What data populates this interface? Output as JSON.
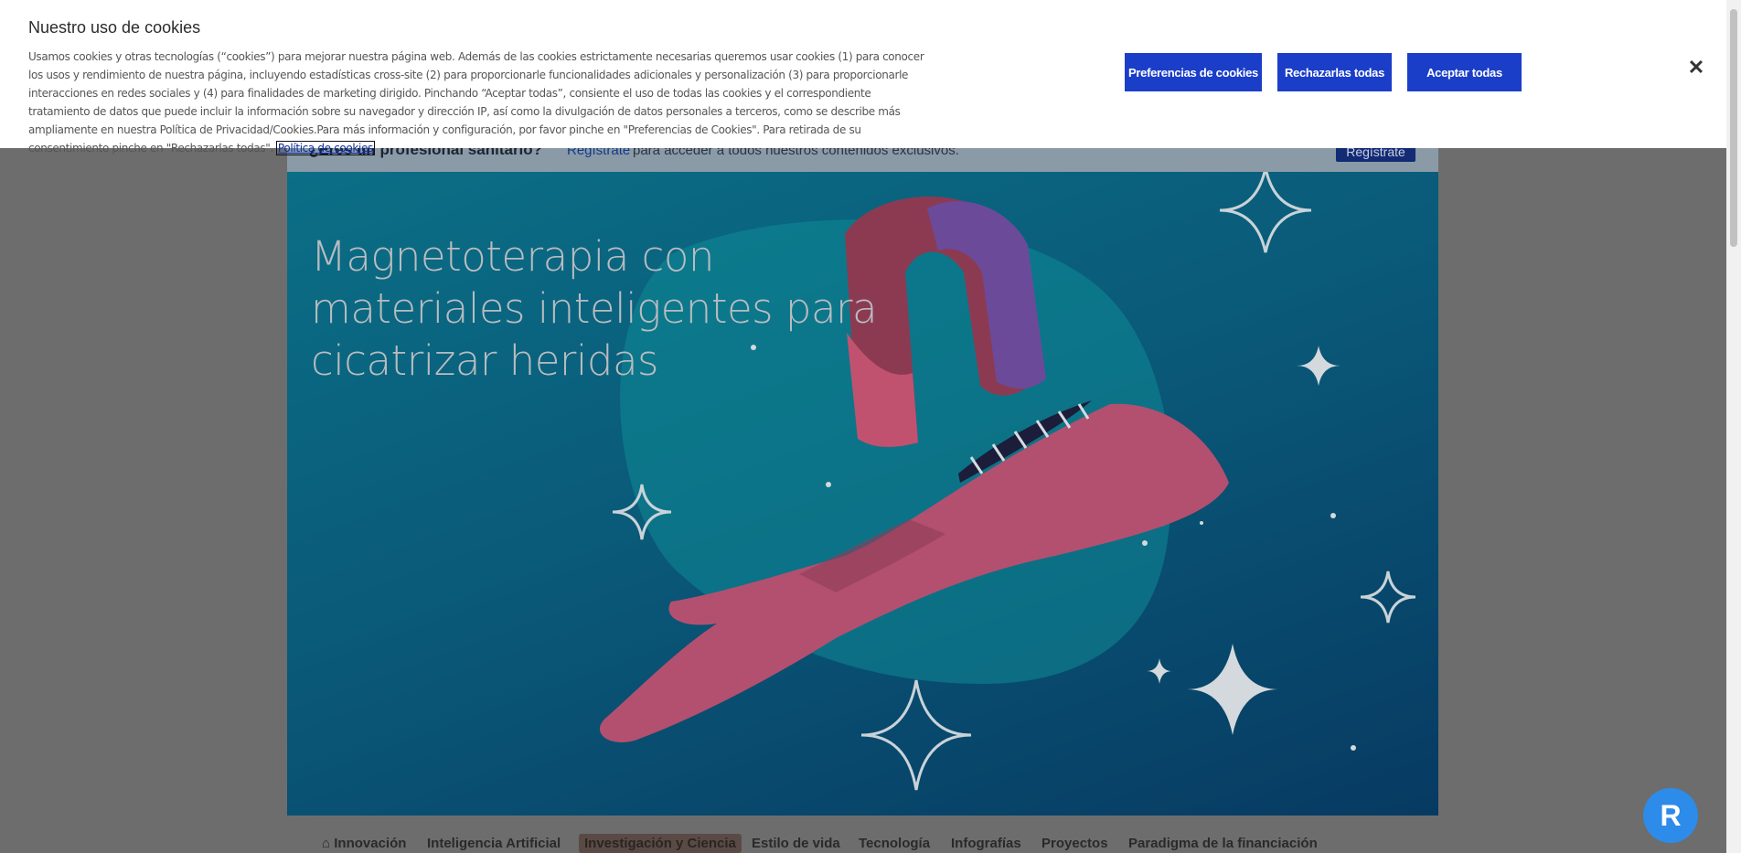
{
  "cookie_banner": {
    "title": "Nuestro uso de cookies",
    "body": "Usamos cookies y otras tecnologías (“cookies”) para mejorar nuestra página web. Además de las cookies estrictamente necesarias queremos usar cookies (1) para conocer los usos y rendimiento de nuestra página, incluyendo estadísticas cross-site (2) para proporcionarle funcionalidades adicionales y personalización (3) para proporcionarle interacciones en redes sociales y (4) para finalidades de marketing dirigido. Pinchando “Aceptar todas”, consiente el uso de todas las cookies y el correspondiente tratamiento de datos que puede incluir la información sobre su navegador y dirección IP, así como la divulgación de datos personales a terceros, como se describe más ampliamente en nuestra Política de Privacidad/Cookies.Para más información y configuración, por favor pinche en \"Preferencias de Cookies\". Para retirada de su consentimiento pinche en \"Rechazarlas todas\".",
    "policy_link": "Política de cookies",
    "btn_preferences": "Preferencias de cookies",
    "btn_reject": "Rechazarlas todas",
    "btn_accept": "Aceptar todas",
    "close_icon": "close-icon"
  },
  "pro_bar": {
    "question": "¿Eres un profesional sanitario?",
    "link": "Regístrate",
    "text": "para acceder a todos nuestros contenidos exclusivos.",
    "button": "Regístrate"
  },
  "hero": {
    "title": "Magnetoterapia con materiales inteligentes para cicatrizar heridas"
  },
  "nav": {
    "items": [
      "Innovación",
      "Inteligencia Artificial",
      "Investigación y Ciencia",
      "Estilo de vida",
      "Tecnología",
      "Infografías",
      "Proyectos",
      "Paradigma de la financiación"
    ],
    "active": "Investigación y Ciencia"
  },
  "colors": {
    "accent": "#1b3ec9",
    "hero_bg": "#0a5a79",
    "fab": "#2d8bea"
  }
}
